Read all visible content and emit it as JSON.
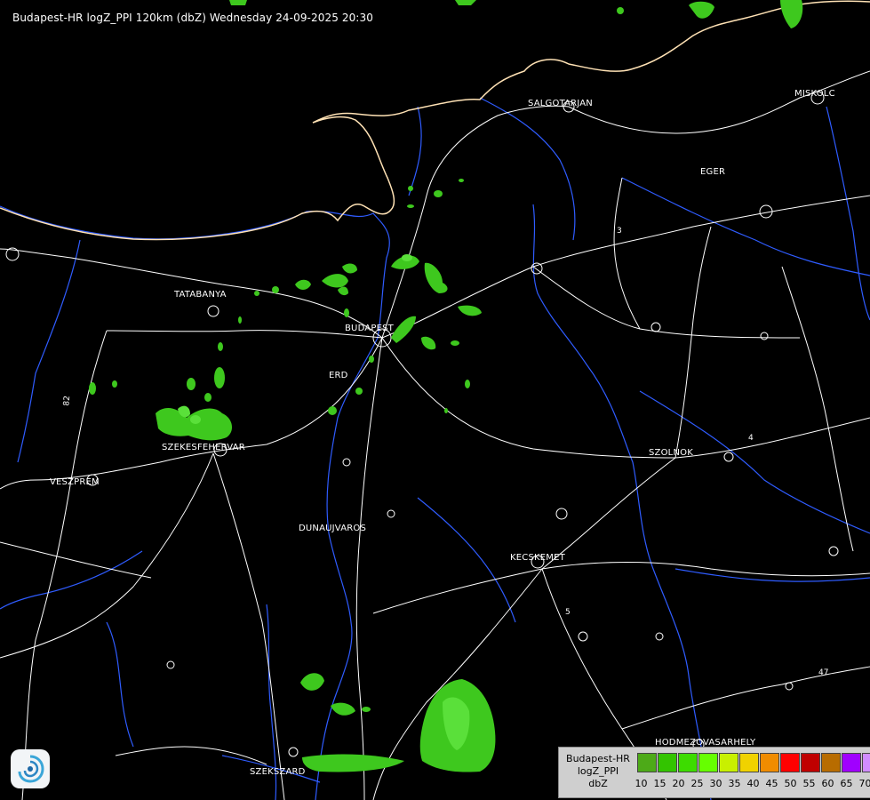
{
  "header": {
    "title": "Budapest-HR logZ_PPI 120km (dbZ) Wednesday 24-09-2025 20:30"
  },
  "cities": [
    {
      "name": "SALGÓTARJÁN",
      "label": "SALGOTARJAN"
    },
    {
      "name": "MISKOLC",
      "label": "MISKOLC"
    },
    {
      "name": "EGER",
      "label": "EGER"
    },
    {
      "name": "TATABÁNYA",
      "label": "TATABANYA"
    },
    {
      "name": "BUDAPEST",
      "label": "BUDAPEST"
    },
    {
      "name": "ÉRD",
      "label": "ERD"
    },
    {
      "name": "SZÉKESFEHÉRVÁR",
      "label": "SZEKESFEHERVAR"
    },
    {
      "name": "VESZPRÉM",
      "label": "VESZPREM"
    },
    {
      "name": "SZOLNOK",
      "label": "SZOLNOK"
    },
    {
      "name": "DUNAÚJVÁROS",
      "label": "DUNAUJVAROS"
    },
    {
      "name": "KECSKEMÉT",
      "label": "KECSKEMET"
    },
    {
      "name": "HÓDMEZŐVÁSÁRHELY",
      "label": "HODMEZOVASARHELY"
    },
    {
      "name": "SZEKSZÁRD",
      "label": "SZEKSZARD"
    }
  ],
  "road_numbers": [
    "82",
    "3",
    "4",
    "47",
    "5"
  ],
  "legend": {
    "label_lines": [
      "Budapest-HR",
      "logZ_PPI",
      "dbZ"
    ],
    "values": [
      "10",
      "15",
      "20",
      "25",
      "30",
      "35",
      "40",
      "45",
      "50",
      "55",
      "60",
      "65",
      "70"
    ],
    "colors": [
      "#4daa18",
      "#33c400",
      "#3ddc00",
      "#66ff00",
      "#c8f000",
      "#f0d200",
      "#f08c00",
      "#ff0000",
      "#c00000",
      "#b86c00",
      "#a000ff",
      "#d08cff",
      "#b4b4ff"
    ]
  },
  "colors": {
    "background": "#000000",
    "roads": "#ffffff",
    "rivers": "#2f5cff",
    "border": "#ffd9a0",
    "echo_light": "#3ec81e",
    "echo_mid": "#5ae03a"
  },
  "logo": {
    "icon": "met-service-logo-icon"
  }
}
